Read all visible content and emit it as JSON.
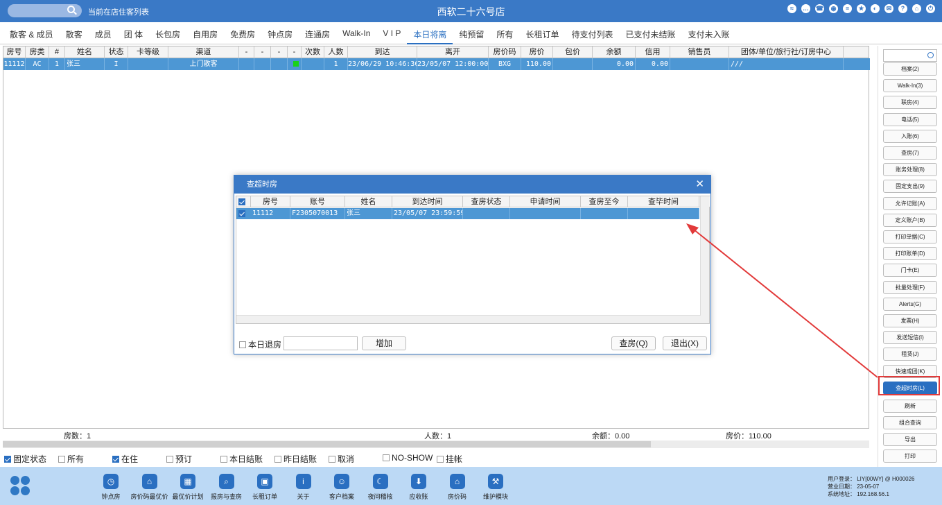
{
  "topbar": {
    "subtitle": "当前在店住客列表",
    "title": "西软二十六号店",
    "icons": [
      "wifi-icon",
      "chat-icon",
      "phone-icon",
      "palette-icon",
      "menu-icon",
      "star-icon",
      "contrast-icon",
      "mail-icon",
      "help-icon",
      "home-icon",
      "power-icon"
    ]
  },
  "tabs": [
    "散客 & 成员",
    "散客",
    "成员",
    "团 体",
    "长包房",
    "自用房",
    "免费房",
    "钟点房",
    "连通房",
    "Walk-In",
    "V I P",
    "本日将离",
    "纯预留",
    "所有",
    "长租订单",
    "待支付列表",
    "已支付未结账",
    "支付未入账"
  ],
  "active_tab": "本日将离",
  "grid": {
    "columns": [
      "房号",
      "房类",
      "#",
      "姓名",
      "状态",
      "卡等级",
      "渠道",
      "-",
      "-",
      "-",
      "-",
      "次数",
      "人数",
      "到达",
      "离开",
      "房价码",
      "房价",
      "包价",
      "余额",
      "信用",
      "销售员",
      "团体/单位/旅行社/订房中心"
    ],
    "rows": [
      [
        "11112",
        "AC",
        "1",
        "张三",
        "I",
        "",
        "上门散客",
        "",
        "",
        "",
        "",
        "",
        "1",
        "23/06/29 10:46:36",
        "23/05/07 12:00:00",
        "BXG",
        "110.00",
        "",
        "0.00",
        "0.00",
        "",
        "///"
      ]
    ]
  },
  "summary": {
    "rooms": "房数：1",
    "persons": "人数：1",
    "balance": "余额：0.00",
    "rate": "房价：110.00"
  },
  "filters": [
    {
      "label": "固定状态",
      "checked": true
    },
    {
      "label": "所有",
      "checked": false
    },
    {
      "label": "在住",
      "checked": true
    },
    {
      "label": "预订",
      "checked": false
    },
    {
      "label": "本日结账",
      "checked": false
    },
    {
      "label": "昨日结账",
      "checked": false
    },
    {
      "label": "取消",
      "checked": false
    },
    {
      "label": "NO-SHOW",
      "checked": false
    },
    {
      "label": "挂帐",
      "checked": false
    }
  ],
  "right_buttons": [
    "档案(2)",
    "Walk-In(3)",
    "联房(4)",
    "电话(5)",
    "入账(6)",
    "查房(7)",
    "账务处理(8)",
    "固定支出(9)",
    "允许记账(A)",
    "定义账户(B)",
    "打印单据(C)",
    "打印账单(D)",
    "门卡(E)",
    "批量处理(F)",
    "Alerts(G)",
    "发票(H)",
    "发送短信(I)",
    "租赁(J)",
    "快速成团(K)",
    "查超时房(L)",
    "刷新",
    "组合查询",
    "导出",
    "打印"
  ],
  "highlighted_button": "查超时房(L)",
  "bottom_items": [
    {
      "label": "钟点房",
      "icon": "clock-icon"
    },
    {
      "label": "房价码最优价",
      "icon": "house-price-icon"
    },
    {
      "label": "最优价计划",
      "icon": "calendar-icon"
    },
    {
      "label": "报房与查房",
      "icon": "house-search-icon"
    },
    {
      "label": "长租订单",
      "icon": "briefcase-icon"
    },
    {
      "label": "关于",
      "icon": "info-icon"
    },
    {
      "label": "客户档案",
      "icon": "profile-icon"
    },
    {
      "label": "夜间稽核",
      "icon": "moon-icon"
    },
    {
      "label": "应收账",
      "icon": "download-icon"
    },
    {
      "label": "房价码",
      "icon": "home-icon"
    },
    {
      "label": "维护模块",
      "icon": "wrench-icon"
    }
  ],
  "sysinfo": {
    "user": "用户登录： LIY[00WY] @ H000026",
    "date": "营业日期： 23-05-07",
    "addr": "系统地址： 192.168.56.1"
  },
  "dialog": {
    "title": "查超时房",
    "columns": [
      "房号",
      "账号",
      "姓名",
      "到达时间",
      "查房状态",
      "申请时间",
      "查房至今",
      "查毕时间"
    ],
    "rows": [
      [
        "11112",
        "F2305070013",
        "张三",
        "23/05/07 23:59:59",
        "",
        "",
        "",
        ""
      ]
    ],
    "checkout_today_label": "本日退房",
    "add_label": "增加",
    "check_label": "查房(Q)",
    "exit_label": "退出(X)"
  },
  "colors": {
    "brand": "#3a79c6",
    "selected_row": "#4d97d4",
    "annotation": "#e23a3a"
  }
}
